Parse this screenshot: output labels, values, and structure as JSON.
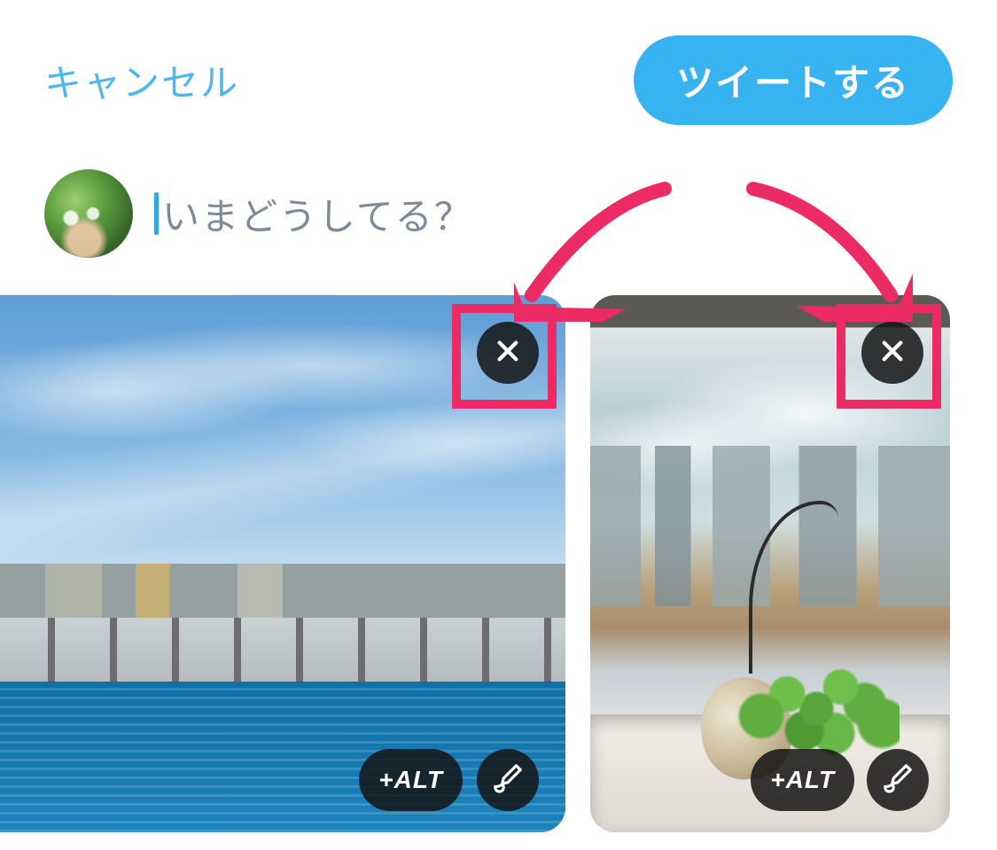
{
  "header": {
    "cancel_label": "キャンセル",
    "tweet_label": "ツイートする"
  },
  "compose": {
    "placeholder": "いまどうしてる？"
  },
  "media": {
    "alt_label": "+ALT"
  },
  "colors": {
    "accent": "#38b3f1",
    "annotation": "#ec2a64"
  }
}
